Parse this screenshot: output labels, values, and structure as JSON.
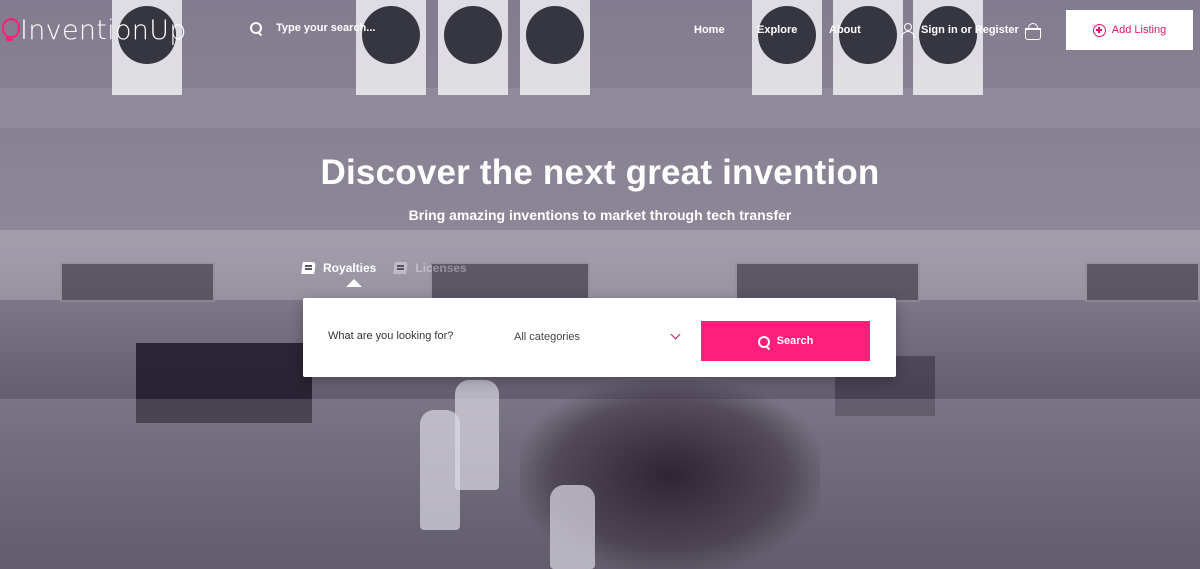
{
  "header": {
    "logo_text": "InventionUp",
    "search_placeholder": "Type your search...",
    "nav": [
      {
        "label": "Home"
      },
      {
        "label": "Explore"
      },
      {
        "label": "About"
      }
    ],
    "sign_in_label": "Sign in or Register",
    "add_listing_label": "Add Listing"
  },
  "hero": {
    "title": "Discover the next great invention",
    "subtitle": "Bring amazing inventions to market through tech transfer"
  },
  "tabs": [
    {
      "label": "Royalties",
      "active": true
    },
    {
      "label": "Licenses",
      "active": false
    }
  ],
  "search_card": {
    "query_placeholder": "What are you looking for?",
    "category_value": "All categories",
    "search_label": "Search"
  },
  "colors": {
    "accent": "#ff1e7b",
    "accent_text": "#e5156f"
  },
  "icons": {
    "logo": "lightbulb-icon",
    "search": "search-icon",
    "user": "user-icon",
    "cart": "basket-icon",
    "add": "plus-circle-icon",
    "tab": "book-icon",
    "dropdown": "chevron-down-icon"
  }
}
